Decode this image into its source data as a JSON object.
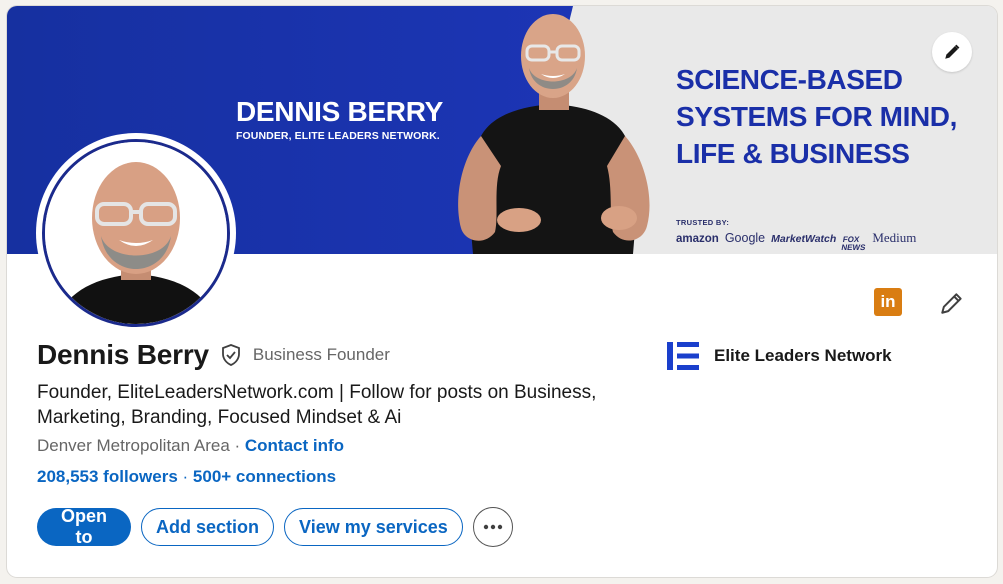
{
  "banner": {
    "name": "DENNIS BERRY",
    "subtitle": "FOUNDER, ELITE LEADERS NETWORK.",
    "tagline": [
      "SCIENCE-BASED",
      "SYSTEMS FOR MIND,",
      "LIFE & BUSINESS"
    ],
    "trusted_label": "TRUSTED BY:",
    "trusted_logos": {
      "amazon": "amazon",
      "google": "Google",
      "marketwatch": "MarketWatch",
      "fox_top": "FOX",
      "fox_bottom": "NEWS",
      "medium": "Medium"
    },
    "edit_icon": "pencil-icon",
    "colors": {
      "blue": "#1b2fa3",
      "tagline": "#1a2fa8"
    }
  },
  "profile": {
    "name": "Dennis Berry",
    "verified_icon": "verified-shield-icon",
    "pronoun_label": "Business Founder",
    "headline": "Founder, EliteLeadersNetwork.com | Follow for posts on Business, Marketing, Branding, Focused Mindset & Ai",
    "location": "Denver Metropolitan Area",
    "location_sep": " · ",
    "contact_link": "Contact info",
    "followers": "208,553 followers",
    "stats_sep": " · ",
    "connections": "500+ connections"
  },
  "company": {
    "name": "Elite Leaders Network",
    "logo_color": "#1a3fcc"
  },
  "icons": {
    "linkedin_icon": "in",
    "linkedin_color": "#d97d12",
    "edit_intro": "pencil-icon"
  },
  "actions": {
    "open_to": "Open to",
    "add_section": "Add section",
    "view_services": "View my services",
    "more": "⋯"
  },
  "colors": {
    "accent": "#0a66c2",
    "text": "#191919",
    "muted": "#666666"
  }
}
